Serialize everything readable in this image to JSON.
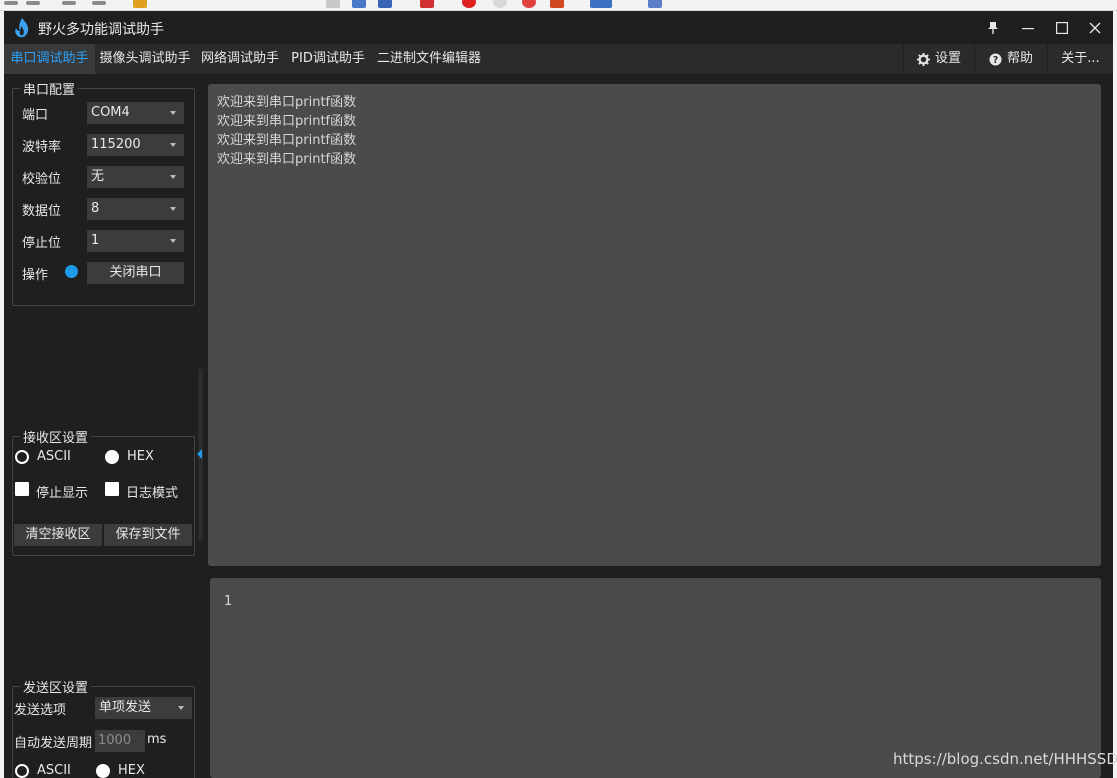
{
  "app": {
    "title": "野火多功能调试助手",
    "accent": "#2aa3ff",
    "background": "#1f1f1f"
  },
  "tabs": [
    {
      "label": "串口调试助手",
      "active": true
    },
    {
      "label": "摄像头调试助手",
      "active": false
    },
    {
      "label": "网络调试助手",
      "active": false
    },
    {
      "label": "PID调试助手",
      "active": false
    },
    {
      "label": "二进制文件编辑器",
      "active": false
    }
  ],
  "toolbar": {
    "settings": {
      "label": "设置",
      "icon": "gear-icon"
    },
    "help": {
      "label": "帮助",
      "icon": "help-icon"
    },
    "about": {
      "label": "关于..."
    }
  },
  "serial_config": {
    "title": "串口配置",
    "port": {
      "label": "端口",
      "value": "COM4"
    },
    "baud": {
      "label": "波特率",
      "value": "115200"
    },
    "parity": {
      "label": "校验位",
      "value": "无"
    },
    "data_bits": {
      "label": "数据位",
      "value": "8"
    },
    "stop_bits": {
      "label": "停止位",
      "value": "1"
    },
    "operation": {
      "label": "操作",
      "button": "关闭串口",
      "status_color": "#1e9be6"
    }
  },
  "recv_settings": {
    "title": "接收区设置",
    "ascii": "ASCII",
    "hex": "HEX",
    "selected": "HEX",
    "stop_display": {
      "label": "停止显示",
      "checked": false
    },
    "log_mode": {
      "label": "日志模式",
      "checked": false
    },
    "clear_button": "清空接收区",
    "save_button": "保存到文件"
  },
  "send_settings": {
    "title": "发送区设置",
    "option": {
      "label": "发送选项",
      "value": "单项发送"
    },
    "period": {
      "label": "自动发送周期",
      "value": "1000",
      "unit": "ms"
    },
    "ascii": "ASCII",
    "hex": "HEX",
    "selected": "HEX"
  },
  "receive_area": {
    "lines": [
      "欢迎来到串口printf函数",
      "欢迎来到串口printf函数",
      "欢迎来到串口printf函数",
      "欢迎来到串口printf函数"
    ]
  },
  "send_area": {
    "text": "1"
  },
  "watermark": "https://blog.csdn.net/HHHSSD"
}
